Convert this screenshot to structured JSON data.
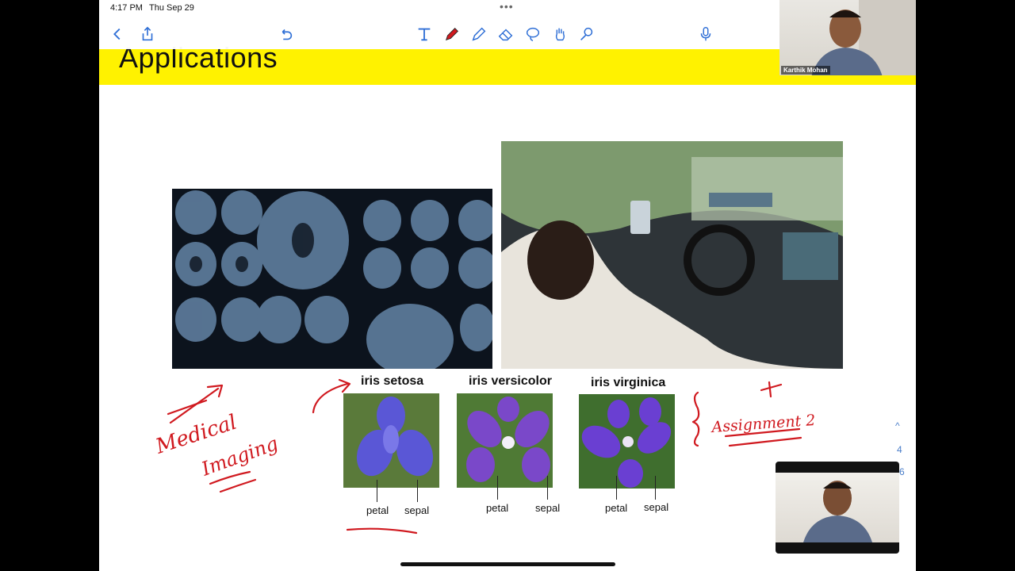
{
  "status": {
    "time": "4:17 PM",
    "date": "Thu Sep 29",
    "dots": "•••"
  },
  "toolbar": {
    "icons": [
      "back-icon",
      "share-icon",
      "undo-icon",
      "text-tool-icon",
      "pen-icon",
      "highlighter-icon",
      "eraser-icon",
      "lasso-icon",
      "hand-icon",
      "shape-tool-icon",
      "microphone-icon"
    ]
  },
  "slide": {
    "title": "Applications",
    "iris": [
      {
        "name": "iris setosa",
        "petal": "petal",
        "sepal": "sepal"
      },
      {
        "name": "iris versicolor",
        "petal": "petal",
        "sepal": "sepal"
      },
      {
        "name": "iris virginica",
        "petal": "petal",
        "sepal": "sepal"
      }
    ],
    "annotations": {
      "medical": "Medical",
      "imaging": "Imaging",
      "assignment": "Assignment 2"
    }
  },
  "video": {
    "presenter": "Karthik Mohan"
  },
  "side": {
    "up": "^",
    "page_current": "4",
    "page_total": "6"
  },
  "colors": {
    "accent": "#fff200",
    "ink": "#d0191f"
  }
}
